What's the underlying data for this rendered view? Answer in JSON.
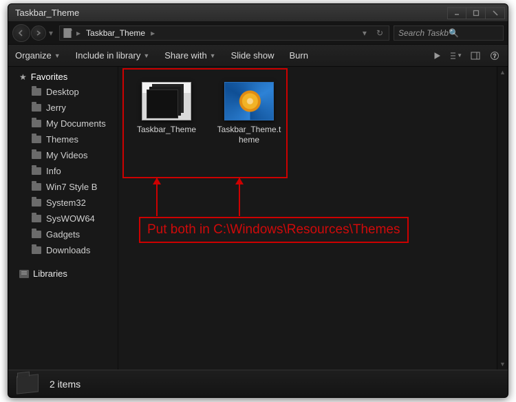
{
  "window": {
    "title": "Taskbar_Theme"
  },
  "breadcrumb": {
    "items": [
      "Taskbar_Theme"
    ]
  },
  "search": {
    "placeholder": "Search Taskbar_T..."
  },
  "toolbar": {
    "organize": "Organize",
    "include": "Include in library",
    "share": "Share with",
    "slideshow": "Slide show",
    "burn": "Burn"
  },
  "sidebar": {
    "favorites_label": "Favorites",
    "favorites": [
      {
        "label": "Desktop"
      },
      {
        "label": "Jerry"
      },
      {
        "label": "My Documents"
      },
      {
        "label": "Themes"
      },
      {
        "label": "My Videos"
      },
      {
        "label": "Info"
      },
      {
        "label": "Win7 Style B"
      },
      {
        "label": "System32"
      },
      {
        "label": "SysWOW64"
      },
      {
        "label": "Gadgets"
      },
      {
        "label": "Downloads"
      }
    ],
    "libraries_label": "Libraries"
  },
  "files": [
    {
      "name": "Taskbar_Theme",
      "kind": "folder"
    },
    {
      "name": "Taskbar_Theme.theme",
      "kind": "theme"
    }
  ],
  "annotation": {
    "text": "Put both in C:\\Windows\\Resources\\Themes"
  },
  "status": {
    "count_text": "2 items"
  }
}
